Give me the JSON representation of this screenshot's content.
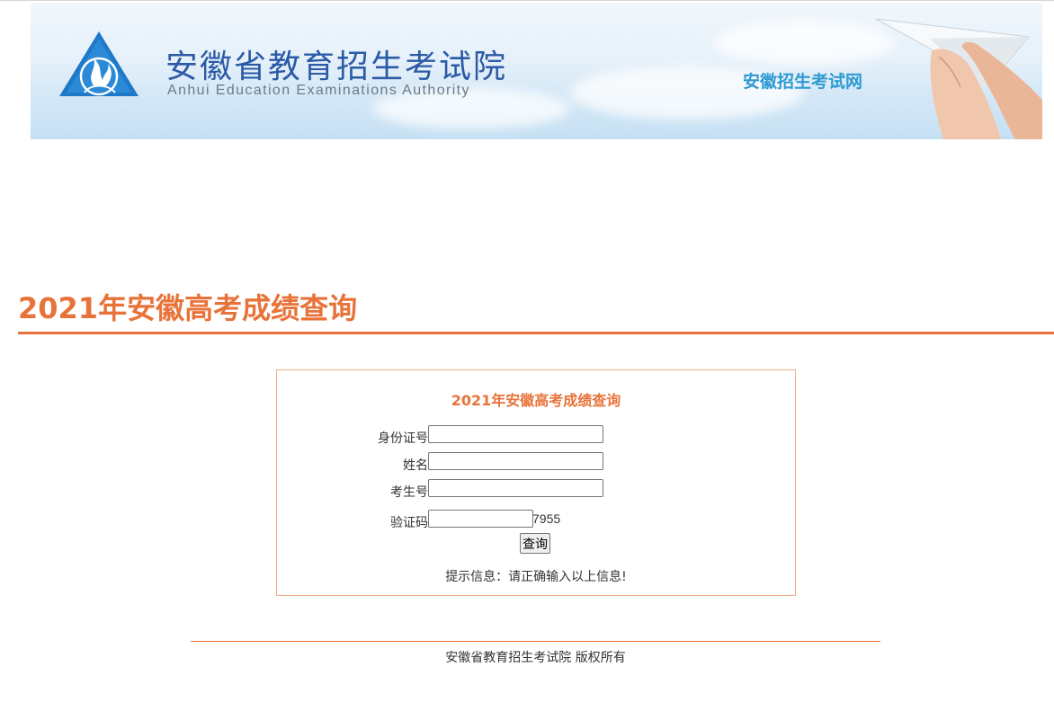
{
  "header": {
    "cn_title": "安徽省教育招生考试院",
    "en_title": "Anhui Education Examinations Authority",
    "site_name": "安徽招生考试网",
    "logo_icon": "triangle-flame-logo-icon",
    "brand_color": "#2b5aa6",
    "accent_blue": "#2f9ad3"
  },
  "page": {
    "title": "2021年安徽高考成绩查询",
    "accent_color": "#e8733a"
  },
  "form": {
    "title": "2021年安徽高考成绩查询",
    "id_label": "身份证号",
    "id_value": "",
    "name_label": "姓名",
    "name_value": "",
    "exam_no_label": "考生号",
    "exam_no_value": "",
    "captcha_label": "验证码",
    "captcha_value": "",
    "captcha_code": "7955",
    "submit_label": "查询",
    "hint": "提示信息：请正确输入以上信息!"
  },
  "footer": {
    "copyright": "安徽省教育招生考试院 版权所有"
  }
}
